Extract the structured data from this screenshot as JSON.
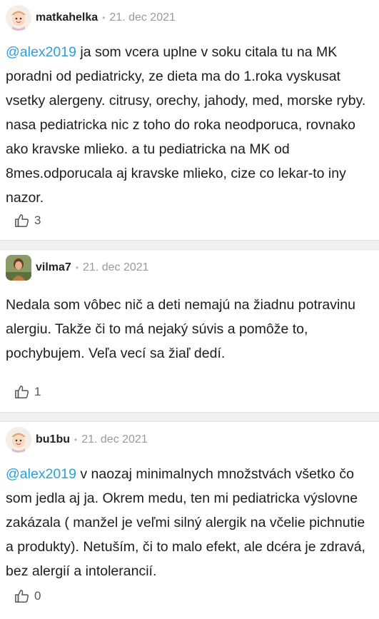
{
  "comments": [
    {
      "username": "matkahelka",
      "date": "21. dec 2021",
      "mention": "@alex2019",
      "text": " ja som vcera uplne v soku citala tu na MK poradni od pediatricky, ze dieta ma do 1.roka vyskusat vsetky alergeny. citrusy, orechy, jahody, med, morske ryby. nasa pediatricka nic z toho do roka neodporuca, rovnako ako kravske mlieko. a tu pediatricka na MK od 8mes.odporucala aj kravske mlieko, cize co lekar-to iny nazor.",
      "likes": "3",
      "avatar_icon": "cartoon-face-icon"
    },
    {
      "username": "vilma7",
      "date": "21. dec 2021",
      "mention": "",
      "text": "Nedala som vôbec nič a deti nemajú na žiadnu potravinu alergiu. Takže či to má nejaký súvis a pomôže to, pochybujem. Veľa vecí sa žiaľ dedí.",
      "likes": "1",
      "avatar_icon": "user-photo-icon"
    },
    {
      "username": "bu1bu",
      "date": "21. dec 2021",
      "mention": "@alex2019",
      "text": " v naozaj minimalnych množstvách všetko čo som jedla aj ja. Okrem medu, ten mi pediatricka výslovne zakázala ( manžel je veľmi silný alergik na včelie pichnutie a produkty). Netuším, či to malo efekt, ale dcéra je zdravá, bez alergií a intolerancií.",
      "likes": "0",
      "avatar_icon": "cartoon-face-icon"
    }
  ],
  "colors": {
    "mention": "#2f9fd6",
    "divider": "#f0f0f0"
  }
}
